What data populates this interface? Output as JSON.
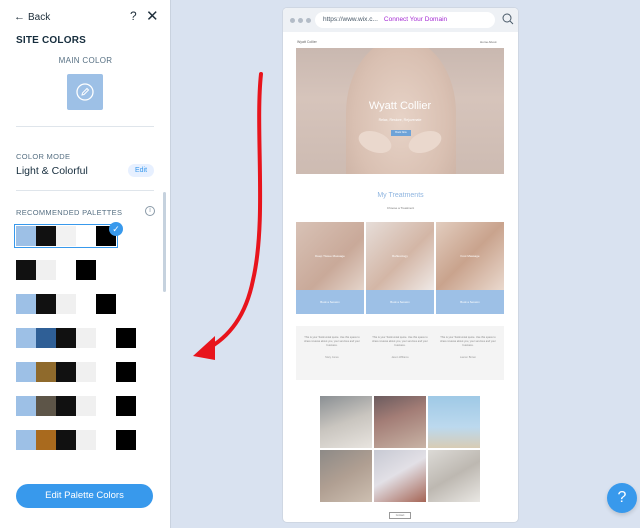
{
  "panel": {
    "back_label": "Back",
    "help_glyph": "?",
    "close_glyph": "✕",
    "title": "SITE COLORS",
    "main_color_label": "MAIN COLOR",
    "main_color": "#9dc0e6",
    "color_mode_label": "COLOR MODE",
    "color_mode_value": "Light & Colorful",
    "edit_label": "Edit",
    "recommended_label": "RECOMMENDED PALETTES",
    "info_glyph": "i",
    "palettes": [
      {
        "colors": [
          "#9dc0e6",
          "#111111",
          "#f2f2f2",
          "#ffffff",
          "#000000"
        ],
        "selected": true
      },
      {
        "colors": [
          "#111111",
          "#f0f0f0",
          "#ffffff",
          "#000000"
        ],
        "selected": false
      },
      {
        "colors": [
          "#9dc0e6",
          "#111111",
          "#f0f0f0",
          "#ffffff",
          "#000000"
        ],
        "selected": false
      },
      {
        "colors": [
          "#9dc0e6",
          "#2f5f96",
          "#111111",
          "#f0f0f0",
          "#ffffff",
          "#000000"
        ],
        "selected": false
      },
      {
        "colors": [
          "#9dc0e6",
          "#8f6a2c",
          "#111111",
          "#f0f0f0",
          "#ffffff",
          "#000000"
        ],
        "selected": false
      },
      {
        "colors": [
          "#9dc0e6",
          "#5d5548",
          "#111111",
          "#f0f0f0",
          "#ffffff",
          "#000000"
        ],
        "selected": false
      },
      {
        "colors": [
          "#9dc0e6",
          "#a96a1e",
          "#111111",
          "#f0f0f0",
          "#ffffff",
          "#000000"
        ],
        "selected": false
      }
    ],
    "edit_palette_label": "Edit Palette Colors",
    "accent": "#3899ec"
  },
  "browser": {
    "url": "https://www.wix.c...",
    "connect_label": "Connect Your Domain",
    "site_logo": "Wyatt Collier",
    "site_nav": "Home   About",
    "hero_title": "Wyatt Collier",
    "hero_subtitle": "Relax, Restore, Rejuvenate",
    "hero_button": "Book Now",
    "treatments_title": "My Treatments",
    "treatments_subtitle": "Choose a Treatment",
    "treatments": [
      {
        "name": "Deep Tissue Massage",
        "label": "Book a Session"
      },
      {
        "name": "Reflexology",
        "label": "Book a Session"
      },
      {
        "name": "Foot Massage",
        "label": "Book a Session"
      }
    ],
    "testimonials": [
      {
        "text": "This is your Testimonial quote. Use this space to share reviews about you, your services and your business.",
        "who": "Mary Jones"
      },
      {
        "text": "This is your Testimonial quote. Use this space to share reviews about you, your services and your business.",
        "who": "Jason Williams"
      },
      {
        "text": "This is your Testimonial quote. Use this space to share reviews about you, your services and your business.",
        "who": "Lauren Brown"
      }
    ],
    "footer_label": "Contact"
  },
  "help_button": "?"
}
